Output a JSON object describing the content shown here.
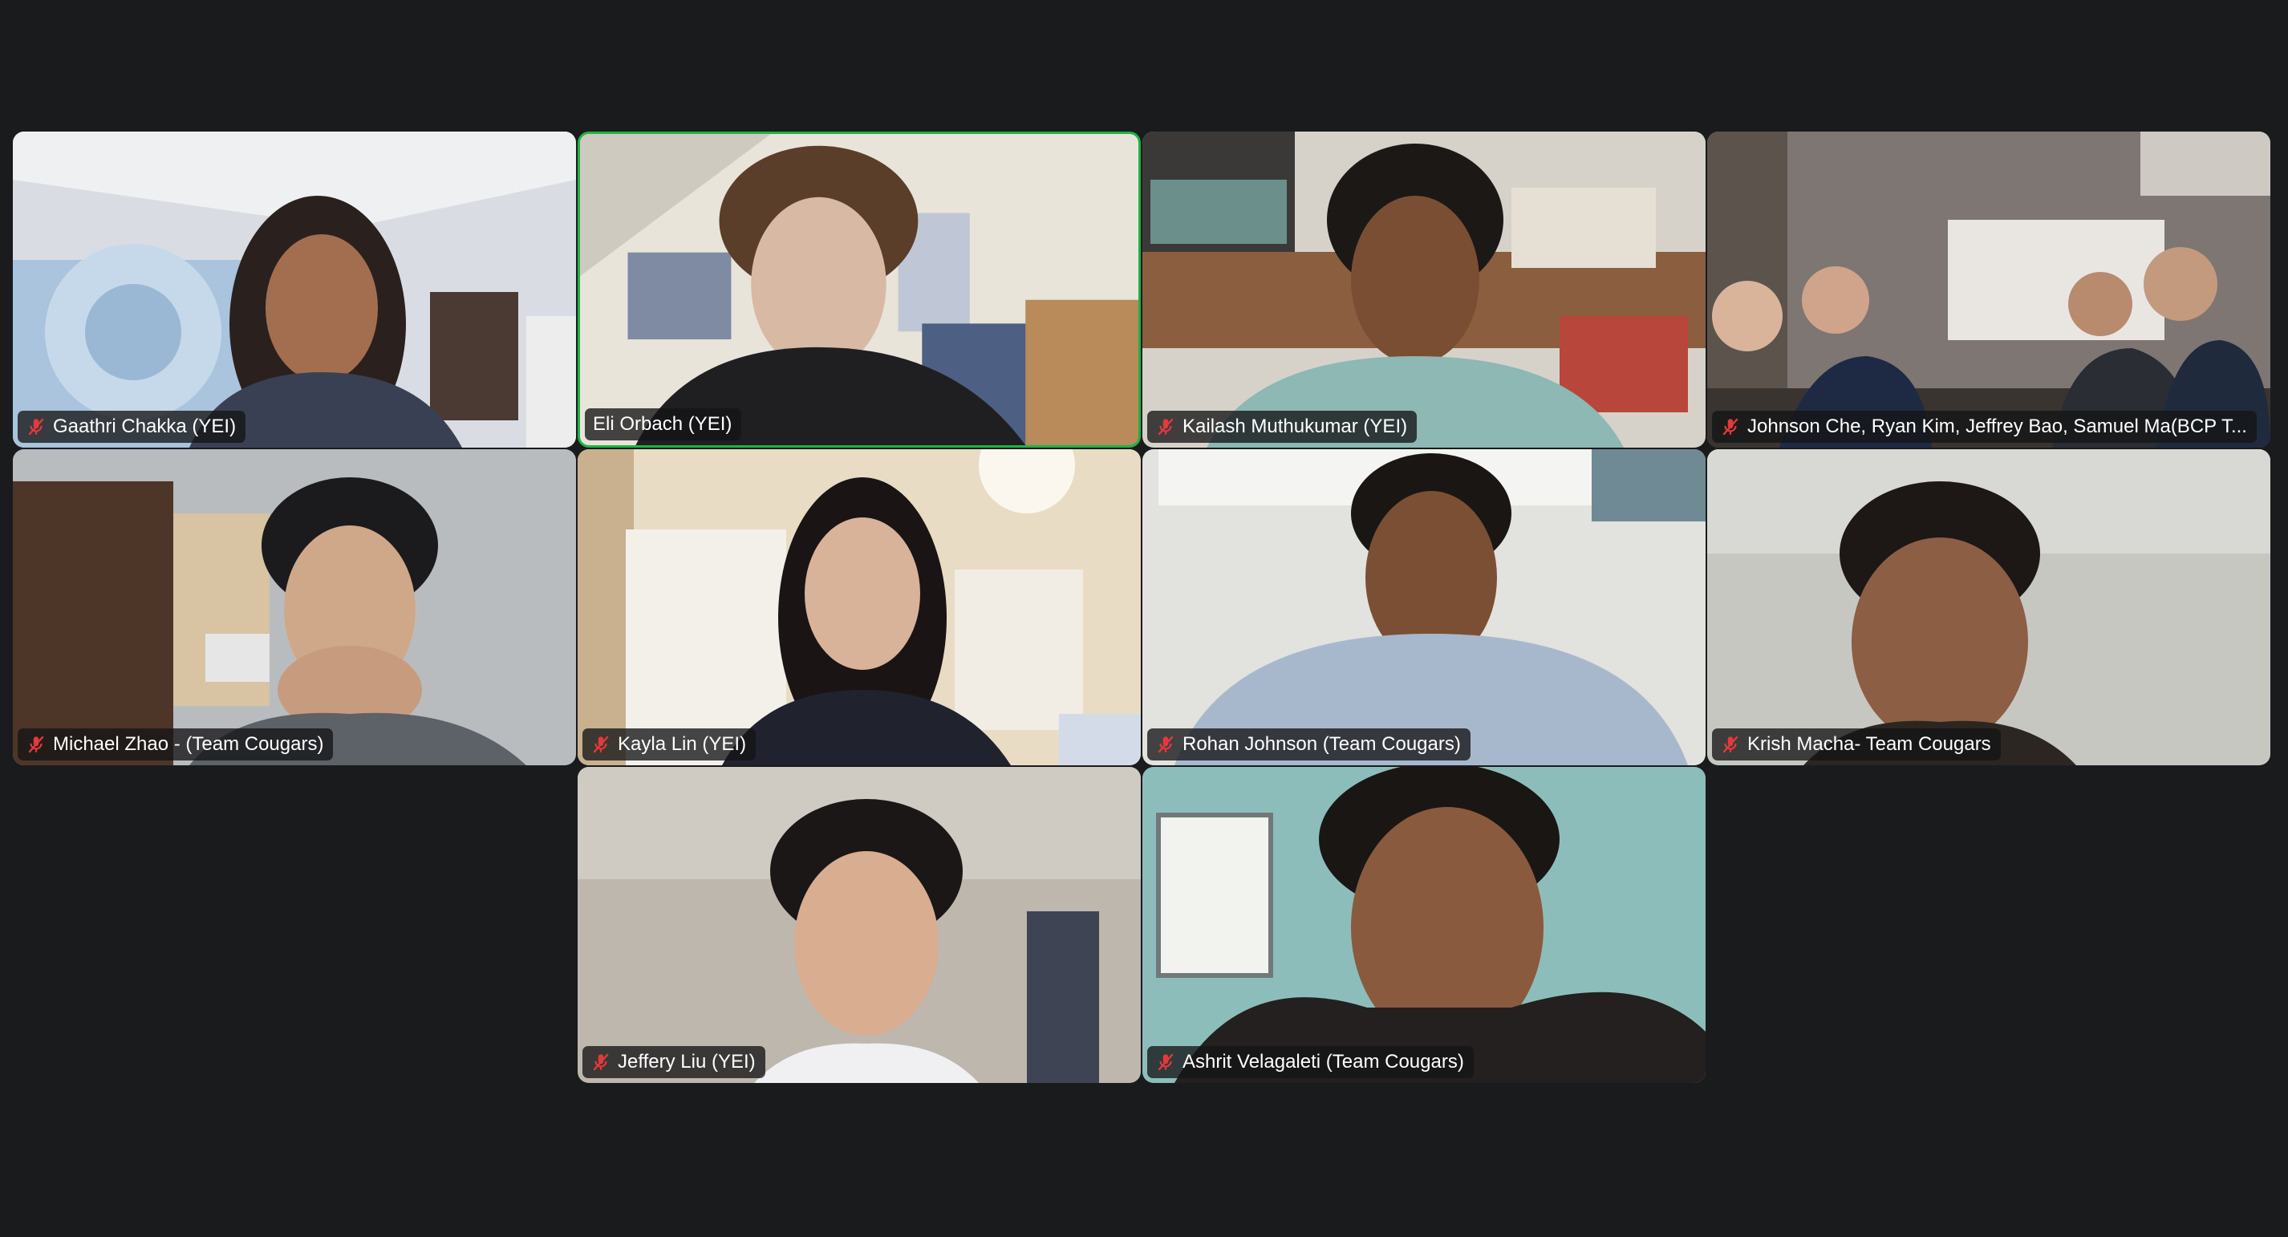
{
  "app": {
    "view": "gallery",
    "accent_active": "#1db342",
    "muted_icon_color": "#e5393b"
  },
  "participants": [
    {
      "name": "Gaathri Chakka (YEI)",
      "muted": true,
      "active_speaker": false,
      "scene": "bedroom-blue-flower-wall"
    },
    {
      "name": "Eli Orbach (YEI)",
      "muted": false,
      "active_speaker": true,
      "scene": "bedroom-slanted-ceiling"
    },
    {
      "name": "Kailash Muthukumar (YEI)",
      "muted": true,
      "active_speaker": false,
      "scene": "bed-headboard-shelves"
    },
    {
      "name": "Johnson Che, Ryan Kim, Jeffrey Bao, Samuel Ma(BCP T...",
      "muted": true,
      "active_speaker": false,
      "scene": "group-room"
    },
    {
      "name": "Michael Zhao - (Team Cougars)",
      "muted": true,
      "active_speaker": false,
      "scene": "room-wood-door"
    },
    {
      "name": "Kayla Lin (YEI)",
      "muted": true,
      "active_speaker": false,
      "scene": "bedroom-closet"
    },
    {
      "name": "Rohan Johnson (Team Cougars)",
      "muted": true,
      "active_speaker": false,
      "scene": "white-wall"
    },
    {
      "name": "Krish Macha- Team Cougars",
      "muted": true,
      "active_speaker": false,
      "scene": "grey-wall"
    },
    {
      "name": "Jeffery Liu (YEI)",
      "muted": true,
      "active_speaker": false,
      "scene": "beige-room"
    },
    {
      "name": "Ashrit Velagaleti (Team Cougars)",
      "muted": true,
      "active_speaker": false,
      "scene": "teal-wall-window"
    }
  ]
}
